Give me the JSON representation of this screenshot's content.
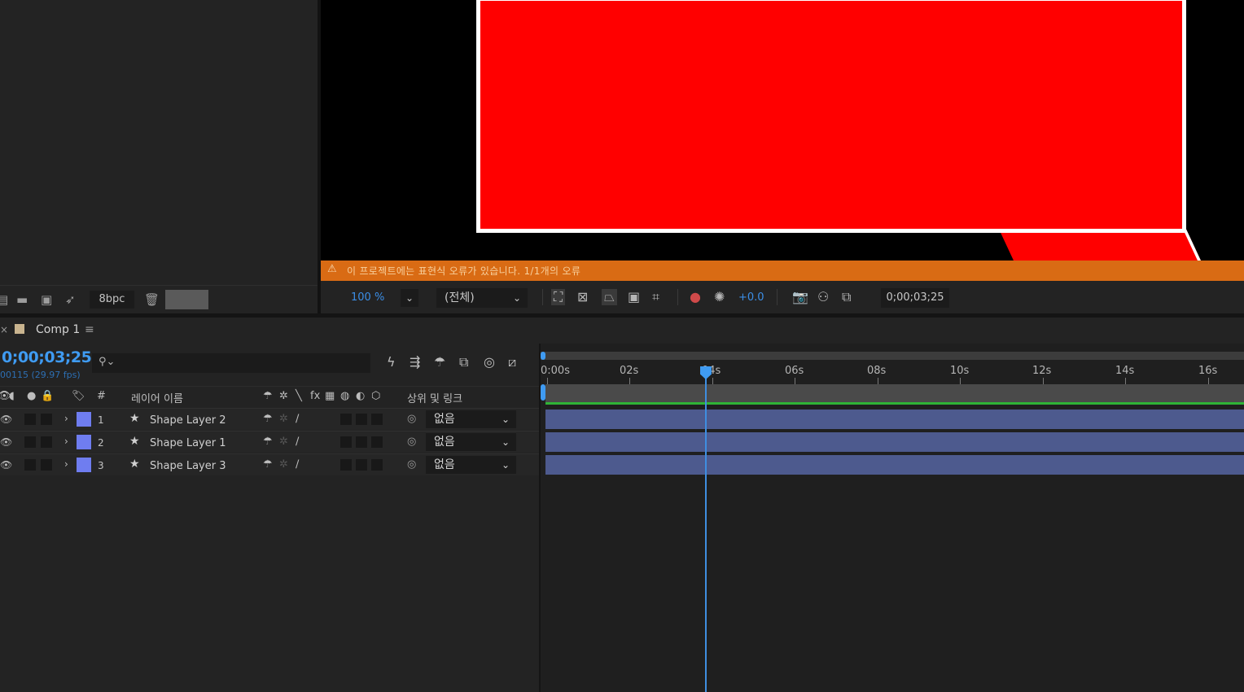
{
  "project": {
    "bit_depth": "8bpc"
  },
  "viewer": {
    "warning": "이 프로젝트에는 표현식 오류가 있습니다. 1/1개의 오류",
    "zoom": "100",
    "zoom_unit": "%",
    "resolution": "(전체)",
    "exposure": "+0.0",
    "timecode": "0;00;03;25",
    "shape_color": "#ff0000"
  },
  "timeline": {
    "tab_label": "Comp 1",
    "current_time": "0;00;03;25",
    "frame_info": "00115 (29.97 fps)",
    "columns": {
      "number": "#",
      "layer_name": "레이어 이름",
      "parent_link": "상위 및 링크",
      "fx": "fx"
    },
    "layers": [
      {
        "num": "1",
        "name": "Shape Layer 2",
        "parent": "없음"
      },
      {
        "num": "2",
        "name": "Shape Layer 1",
        "parent": "없음"
      },
      {
        "num": "3",
        "name": "Shape Layer 3",
        "parent": "없음"
      }
    ],
    "ruler": [
      "0:00s",
      "02s",
      "04s",
      "06s",
      "08s",
      "10s",
      "12s",
      "14s",
      "16s"
    ],
    "playhead_seconds": 3.83,
    "layer_bar_color": "#4d5a8e",
    "accent_color": "#3f9bf2"
  }
}
